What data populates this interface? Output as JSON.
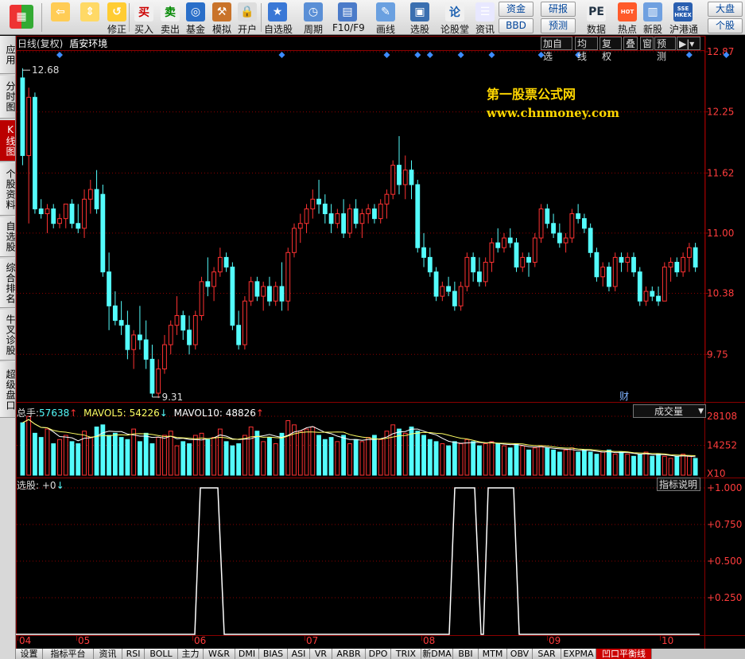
{
  "toolbar": {
    "items": [
      {
        "label": "",
        "icon": "windows-icon"
      },
      {
        "label": "",
        "icon": "back-arrow-icon"
      },
      {
        "label": "",
        "icon": "up-down-arrow-icon"
      },
      {
        "label": "修正",
        "icon": "refresh-icon"
      },
      {
        "label": "买入",
        "icon": "buy-icon",
        "glyph": "买"
      },
      {
        "label": "卖出",
        "icon": "sell-icon",
        "glyph": "卖"
      },
      {
        "label": "基金",
        "icon": "fund-icon"
      },
      {
        "label": "模拟",
        "icon": "gavel-icon"
      },
      {
        "label": "开户",
        "icon": "lock-icon"
      },
      {
        "label": "自选股",
        "icon": "star-window-icon"
      },
      {
        "label": "周期",
        "icon": "clock-icon"
      },
      {
        "label": "F10/F9",
        "icon": "f10-icon"
      },
      {
        "label": "画线",
        "icon": "pen-icon"
      },
      {
        "label": "选股",
        "icon": "screen-icon"
      },
      {
        "label": "论股堂",
        "icon": "forum-icon",
        "glyph": "论"
      },
      {
        "label": "资讯",
        "icon": "news-icon"
      },
      {
        "label": "数据",
        "icon": "pe-icon",
        "glyph": "PE"
      },
      {
        "label": "热点",
        "icon": "hot-icon",
        "glyph": "HOT"
      },
      {
        "label": "新股",
        "icon": "new-stock-icon"
      },
      {
        "label": "沪港通",
        "icon": "sse-hkex-icon",
        "glyph": "SSE HKEX"
      }
    ],
    "funds_label": "资金",
    "bbd_label": "BBD",
    "research_label": "研报",
    "forecast_label": "预测",
    "market_label": "大盘",
    "stock_label": "个股"
  },
  "left_tabs": [
    "应用",
    "分时图",
    "K线图",
    "个股资料",
    "自选股",
    "综合排名",
    "牛叉诊股",
    "超级盘口"
  ],
  "chart": {
    "period_label": "日线(复权)",
    "stock_name": "盾安环境",
    "buttons": [
      "加自选",
      "均线",
      "复权",
      "叠",
      "窗",
      "预测"
    ],
    "price_axis": [
      "12.87",
      "12.25",
      "11.62",
      "11.00",
      "10.38",
      "9.75"
    ],
    "high_label": "12.68",
    "low_label": "9.31",
    "watermark_title": "第一股票公式网",
    "watermark_url": "www.chnmoney.com",
    "finance_marker": "财",
    "volume": {
      "label_total": "总手:",
      "total": "57638",
      "mavol5_label": "MAVOL5:",
      "mavol5": "54226",
      "mavol10_label": "MAVOL10:",
      "mavol10": "48826",
      "dropdown": "成交量",
      "axis": [
        "28108",
        "14252",
        "X10"
      ]
    },
    "indicator": {
      "label": "选股:",
      "value": "+0",
      "explain_button": "指标说明",
      "axis": [
        "+1.000",
        "+0.750",
        "+0.500",
        "+0.250"
      ]
    },
    "months": [
      "04",
      "05",
      "06",
      "07",
      "08",
      "09",
      "10"
    ]
  },
  "bottom_tabs": [
    "设置",
    "指标平台",
    "资讯",
    "RSI",
    "BOLL",
    "主力",
    "W&R",
    "DMI",
    "BIAS",
    "ASI",
    "VR",
    "ARBR",
    "DPO",
    "TRIX",
    "新DMA",
    "BBI",
    "MTM",
    "OBV",
    "SAR",
    "EXPMA",
    "凹口平衡线"
  ],
  "colors": {
    "up": "#ff3232",
    "down": "#54fcfc",
    "grid": "#8b0000",
    "axis_text": "#ff3c3c",
    "watermark": "#ffd700",
    "marker": "#3c8cff"
  },
  "chart_data": {
    "type": "candlestick",
    "price_ylim": [
      9.31,
      12.87
    ],
    "candles": [
      [
        12.6,
        12.7,
        11.7,
        11.8
      ],
      [
        11.8,
        12.5,
        11.1,
        12.4
      ],
      [
        12.4,
        12.45,
        11.2,
        11.25
      ],
      [
        11.25,
        11.35,
        11.15,
        11.2
      ],
      [
        11.2,
        11.3,
        11.0,
        11.25
      ],
      [
        11.25,
        11.3,
        11.05,
        11.1
      ],
      [
        11.1,
        11.2,
        11.05,
        11.15
      ],
      [
        11.15,
        11.3,
        11.05,
        11.3
      ],
      [
        11.3,
        11.35,
        11.05,
        11.1
      ],
      [
        11.1,
        11.3,
        11.0,
        11.05
      ],
      [
        11.05,
        11.45,
        10.95,
        11.35
      ],
      [
        11.35,
        11.55,
        11.2,
        11.45
      ],
      [
        11.45,
        11.65,
        11.2,
        11.25
      ],
      [
        11.4,
        11.5,
        10.55,
        10.6
      ],
      [
        10.6,
        10.8,
        10.0,
        10.25
      ],
      [
        10.25,
        10.4,
        10.05,
        10.1
      ],
      [
        10.1,
        10.3,
        9.95,
        10.05
      ],
      [
        10.05,
        10.2,
        9.7,
        9.8
      ],
      [
        9.8,
        10.0,
        9.6,
        9.95
      ],
      [
        9.95,
        10.25,
        9.8,
        9.9
      ],
      [
        9.9,
        10.1,
        9.6,
        9.7
      ],
      [
        9.7,
        9.85,
        9.31,
        9.35
      ],
      [
        9.35,
        9.7,
        9.3,
        9.6
      ],
      [
        9.6,
        9.95,
        9.55,
        9.85
      ],
      [
        9.85,
        10.1,
        9.75,
        10.05
      ],
      [
        10.05,
        10.35,
        9.95,
        10.15
      ],
      [
        10.15,
        10.2,
        9.9,
        10.0
      ],
      [
        10.0,
        10.15,
        9.75,
        9.85
      ],
      [
        9.85,
        10.2,
        9.8,
        10.15
      ],
      [
        10.15,
        10.55,
        10.1,
        10.5
      ],
      [
        10.5,
        10.75,
        10.35,
        10.45
      ],
      [
        10.45,
        10.65,
        10.3,
        10.6
      ],
      [
        10.6,
        10.85,
        10.55,
        10.75
      ],
      [
        10.75,
        10.8,
        10.6,
        10.65
      ],
      [
        10.65,
        10.7,
        10.0,
        10.05
      ],
      [
        10.05,
        10.2,
        9.8,
        9.85
      ],
      [
        9.85,
        10.35,
        9.8,
        10.3
      ],
      [
        10.3,
        10.55,
        10.25,
        10.5
      ],
      [
        10.5,
        10.55,
        10.3,
        10.35
      ],
      [
        10.35,
        10.5,
        10.2,
        10.45
      ],
      [
        10.45,
        10.55,
        10.25,
        10.3
      ],
      [
        10.3,
        10.5,
        10.25,
        10.45
      ],
      [
        10.45,
        10.7,
        10.2,
        10.3
      ],
      [
        10.3,
        10.85,
        10.2,
        10.8
      ],
      [
        10.8,
        11.1,
        10.75,
        11.05
      ],
      [
        11.05,
        11.2,
        10.9,
        11.1
      ],
      [
        11.1,
        11.3,
        11.0,
        11.25
      ],
      [
        11.25,
        11.45,
        11.15,
        11.35
      ],
      [
        11.35,
        11.55,
        11.2,
        11.3
      ],
      [
        11.3,
        11.4,
        11.1,
        11.2
      ],
      [
        11.2,
        11.3,
        11.0,
        11.1
      ],
      [
        11.1,
        11.25,
        11.05,
        11.2
      ],
      [
        11.2,
        11.35,
        10.95,
        11.0
      ],
      [
        11.0,
        11.3,
        10.95,
        11.25
      ],
      [
        11.25,
        11.35,
        11.05,
        11.1
      ],
      [
        11.1,
        11.25,
        10.95,
        11.2
      ],
      [
        11.2,
        11.3,
        11.1,
        11.25
      ],
      [
        11.25,
        11.3,
        11.1,
        11.15
      ],
      [
        11.15,
        11.35,
        11.1,
        11.3
      ],
      [
        11.3,
        11.45,
        11.15,
        11.4
      ],
      [
        11.4,
        11.75,
        11.35,
        11.7
      ],
      [
        11.7,
        12.0,
        11.4,
        11.5
      ],
      [
        11.5,
        11.8,
        11.35,
        11.65
      ],
      [
        11.65,
        11.75,
        11.35,
        11.5
      ],
      [
        11.5,
        11.55,
        10.8,
        10.85
      ],
      [
        10.85,
        11.0,
        10.65,
        10.75
      ],
      [
        10.75,
        10.85,
        10.55,
        10.6
      ],
      [
        10.6,
        10.65,
        10.3,
        10.35
      ],
      [
        10.35,
        10.5,
        10.3,
        10.45
      ],
      [
        10.45,
        10.55,
        10.35,
        10.4
      ],
      [
        10.4,
        10.5,
        10.2,
        10.25
      ],
      [
        10.25,
        10.5,
        10.2,
        10.45
      ],
      [
        10.45,
        10.8,
        10.4,
        10.75
      ],
      [
        10.75,
        10.8,
        10.5,
        10.6
      ],
      [
        10.6,
        10.75,
        10.45,
        10.5
      ],
      [
        10.5,
        10.75,
        10.45,
        10.7
      ],
      [
        10.7,
        10.95,
        10.6,
        10.9
      ],
      [
        10.9,
        11.05,
        10.8,
        10.85
      ],
      [
        10.85,
        11.0,
        10.8,
        10.95
      ],
      [
        10.95,
        11.05,
        10.85,
        10.9
      ],
      [
        10.9,
        10.95,
        10.6,
        10.65
      ],
      [
        10.65,
        10.8,
        10.6,
        10.75
      ],
      [
        10.75,
        10.8,
        10.55,
        10.7
      ],
      [
        10.7,
        11.0,
        10.65,
        10.95
      ],
      [
        10.95,
        11.3,
        10.9,
        11.25
      ],
      [
        11.25,
        11.3,
        11.05,
        11.1
      ],
      [
        11.1,
        11.2,
        10.95,
        11.0
      ],
      [
        11.0,
        11.1,
        10.85,
        10.9
      ],
      [
        10.9,
        11.0,
        10.8,
        10.95
      ],
      [
        10.95,
        11.25,
        10.9,
        11.2
      ],
      [
        11.2,
        11.3,
        11.1,
        11.15
      ],
      [
        11.15,
        11.2,
        11.0,
        11.05
      ],
      [
        11.05,
        11.1,
        10.75,
        10.8
      ],
      [
        10.8,
        10.85,
        10.5,
        10.55
      ],
      [
        10.55,
        10.7,
        10.45,
        10.65
      ],
      [
        10.65,
        10.7,
        10.4,
        10.45
      ],
      [
        10.45,
        10.8,
        10.4,
        10.75
      ],
      [
        10.75,
        10.8,
        10.6,
        10.7
      ],
      [
        10.7,
        10.8,
        10.6,
        10.75
      ],
      [
        10.75,
        10.8,
        10.55,
        10.6
      ],
      [
        10.6,
        10.65,
        10.25,
        10.3
      ],
      [
        10.3,
        10.45,
        10.25,
        10.4
      ],
      [
        10.4,
        10.45,
        10.3,
        10.35
      ],
      [
        10.35,
        10.45,
        10.25,
        10.3
      ],
      [
        10.3,
        10.7,
        10.3,
        10.65
      ],
      [
        10.65,
        10.75,
        10.5,
        10.7
      ],
      [
        10.7,
        10.75,
        10.55,
        10.6
      ],
      [
        10.6,
        10.8,
        10.55,
        10.75
      ],
      [
        10.75,
        10.9,
        10.6,
        10.85
      ],
      [
        10.85,
        10.9,
        10.6,
        10.65
      ]
    ],
    "volume_ylim": [
      0,
      28108
    ],
    "volume_series": [
      {
        "name": "MAVOL5",
        "color": "#ffffff"
      },
      {
        "name": "MAVOL10",
        "color": "#ffff64"
      }
    ],
    "volumes": [
      25000,
      28108,
      20000,
      18000,
      22000,
      15000,
      17000,
      19000,
      16000,
      15000,
      21000,
      18000,
      23000,
      24000,
      19000,
      20000,
      18000,
      17000,
      22000,
      16000,
      20000,
      15000,
      18000,
      19000,
      21000,
      14000,
      16000,
      15000,
      19000,
      20000,
      17000,
      18000,
      22000,
      16000,
      14000,
      15000,
      19000,
      23000,
      21000,
      16000,
      18000,
      15000,
      20000,
      26000,
      24000,
      21000,
      22000,
      23000,
      19000,
      17000,
      18000,
      16000,
      19000,
      15000,
      17000,
      16000,
      18000,
      19000,
      17000,
      21000,
      24000,
      22000,
      20000,
      23000,
      21000,
      19000,
      17000,
      16000,
      15000,
      14000,
      16000,
      15000,
      17000,
      16000,
      14000,
      15000,
      16000,
      15000,
      14000,
      13000,
      15000,
      14000,
      12000,
      13000,
      14000,
      13000,
      12000,
      11000,
      12000,
      13000,
      11000,
      12000,
      11000,
      10000,
      11000,
      12000,
      10000,
      11000,
      10000,
      9000,
      10000,
      11000,
      9000,
      10000,
      9000,
      8000,
      9000,
      10000,
      9000,
      8000
    ],
    "indicator_ylim": [
      0,
      1
    ],
    "indicator_values": [
      [
        0,
        0
      ],
      [
        225,
        0
      ],
      [
        232,
        1
      ],
      [
        254,
        1
      ],
      [
        262,
        0
      ],
      [
        545,
        0
      ],
      [
        552,
        1
      ],
      [
        577,
        1
      ],
      [
        585,
        0
      ],
      [
        588,
        0
      ],
      [
        594,
        1
      ],
      [
        626,
        1
      ],
      [
        633,
        0
      ],
      [
        860,
        0
      ]
    ],
    "markers": [
      6,
      42,
      59,
      64,
      66,
      71,
      76,
      84,
      90,
      108,
      114
    ]
  }
}
